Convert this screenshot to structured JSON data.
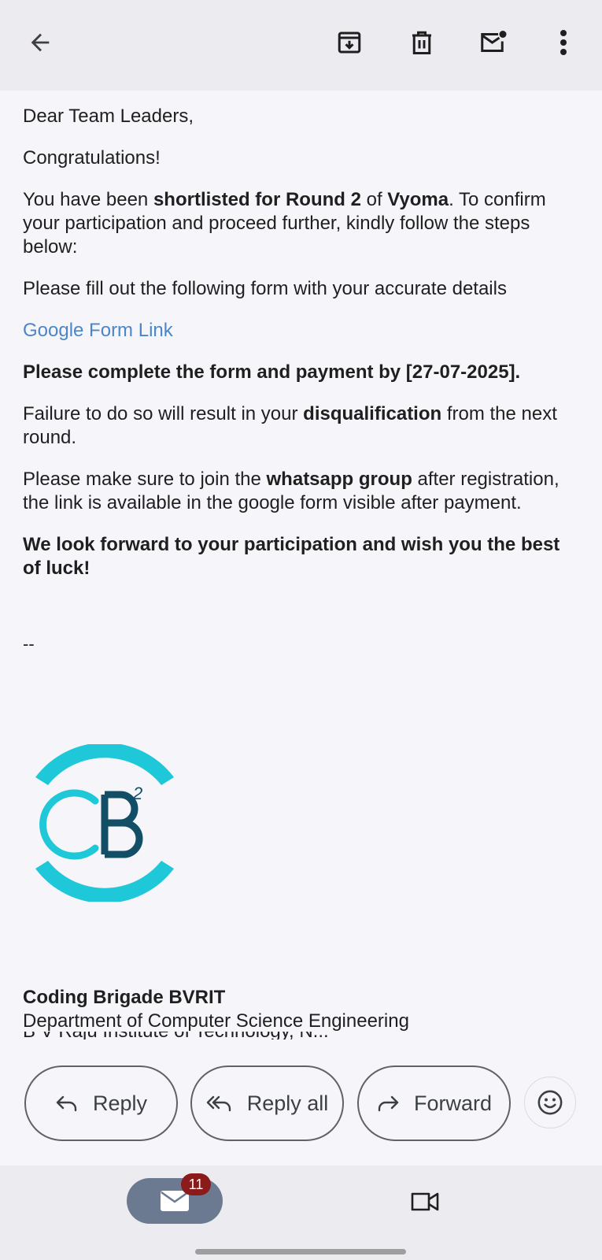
{
  "topbar": {
    "icons": [
      "back-arrow-icon",
      "archive-icon",
      "delete-icon",
      "mark-unread-icon",
      "more-vert-icon"
    ]
  },
  "email": {
    "greeting": "Dear Team Leaders,",
    "congrats": "Congratulations!",
    "p1_a": "You have been ",
    "p1_b": "shortlisted for Round 2",
    "p1_c": " of ",
    "p1_d": "Vyoma",
    "p1_e": ". To confirm your participation and proceed further, kindly follow the steps below:",
    "p2": "Please fill out the following form with your accurate details",
    "link": "Google Form Link",
    "deadline": "Please complete the form and payment by [27-07-2025].",
    "p3_a": "Failure to do so will result in your ",
    "p3_b": "disqualification",
    "p3_c": " from the next round.",
    "p4_a": "Please make sure to join the ",
    "p4_b": "whatsapp group",
    "p4_c": " after registration, the link is available in the google form visible after payment.",
    "closing": "We look forward to your participation and wish you the best of luck!",
    "separator": "--",
    "logo_text": "CB",
    "logo_sup": "2",
    "sig_name": "Coding Brigade BVRIT",
    "sig_dept": "Department of Computer Science Engineering",
    "sig_cut": "B V Raju Institute of Technology, N..."
  },
  "actions": {
    "reply": "Reply",
    "reply_all": "Reply all",
    "forward": "Forward"
  },
  "nav": {
    "mail_badge": "11"
  },
  "colors": {
    "link": "#4a86c8",
    "logo_cyan": "#1ec8d8",
    "logo_teal": "#124e66",
    "badge": "#8b1a1a",
    "mail_pill": "#6b7a90"
  }
}
